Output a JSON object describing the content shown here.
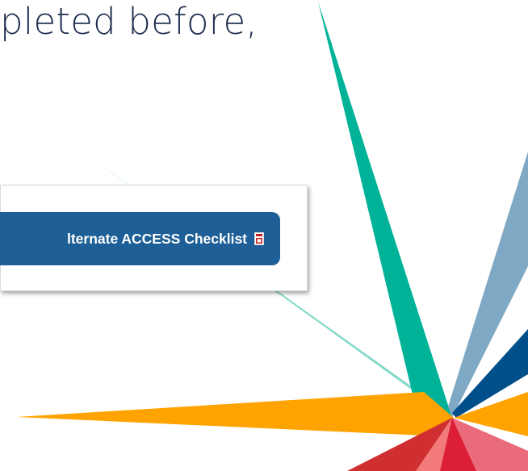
{
  "slide": {
    "heading_text": "pleted before,"
  },
  "button": {
    "label": "lternate ACCESS Checklist",
    "icon": "pdf-file-icon"
  },
  "colors": {
    "heading": "#1f2f4f",
    "button": "#1d5f96",
    "teal": "#00b398",
    "light_teal": "#7fd8c8",
    "steel_blue": "#7fa8c4",
    "navy": "#004f8a",
    "orange": "#ffa300",
    "red": "#d02f31",
    "pink": "#ea6b7b"
  }
}
